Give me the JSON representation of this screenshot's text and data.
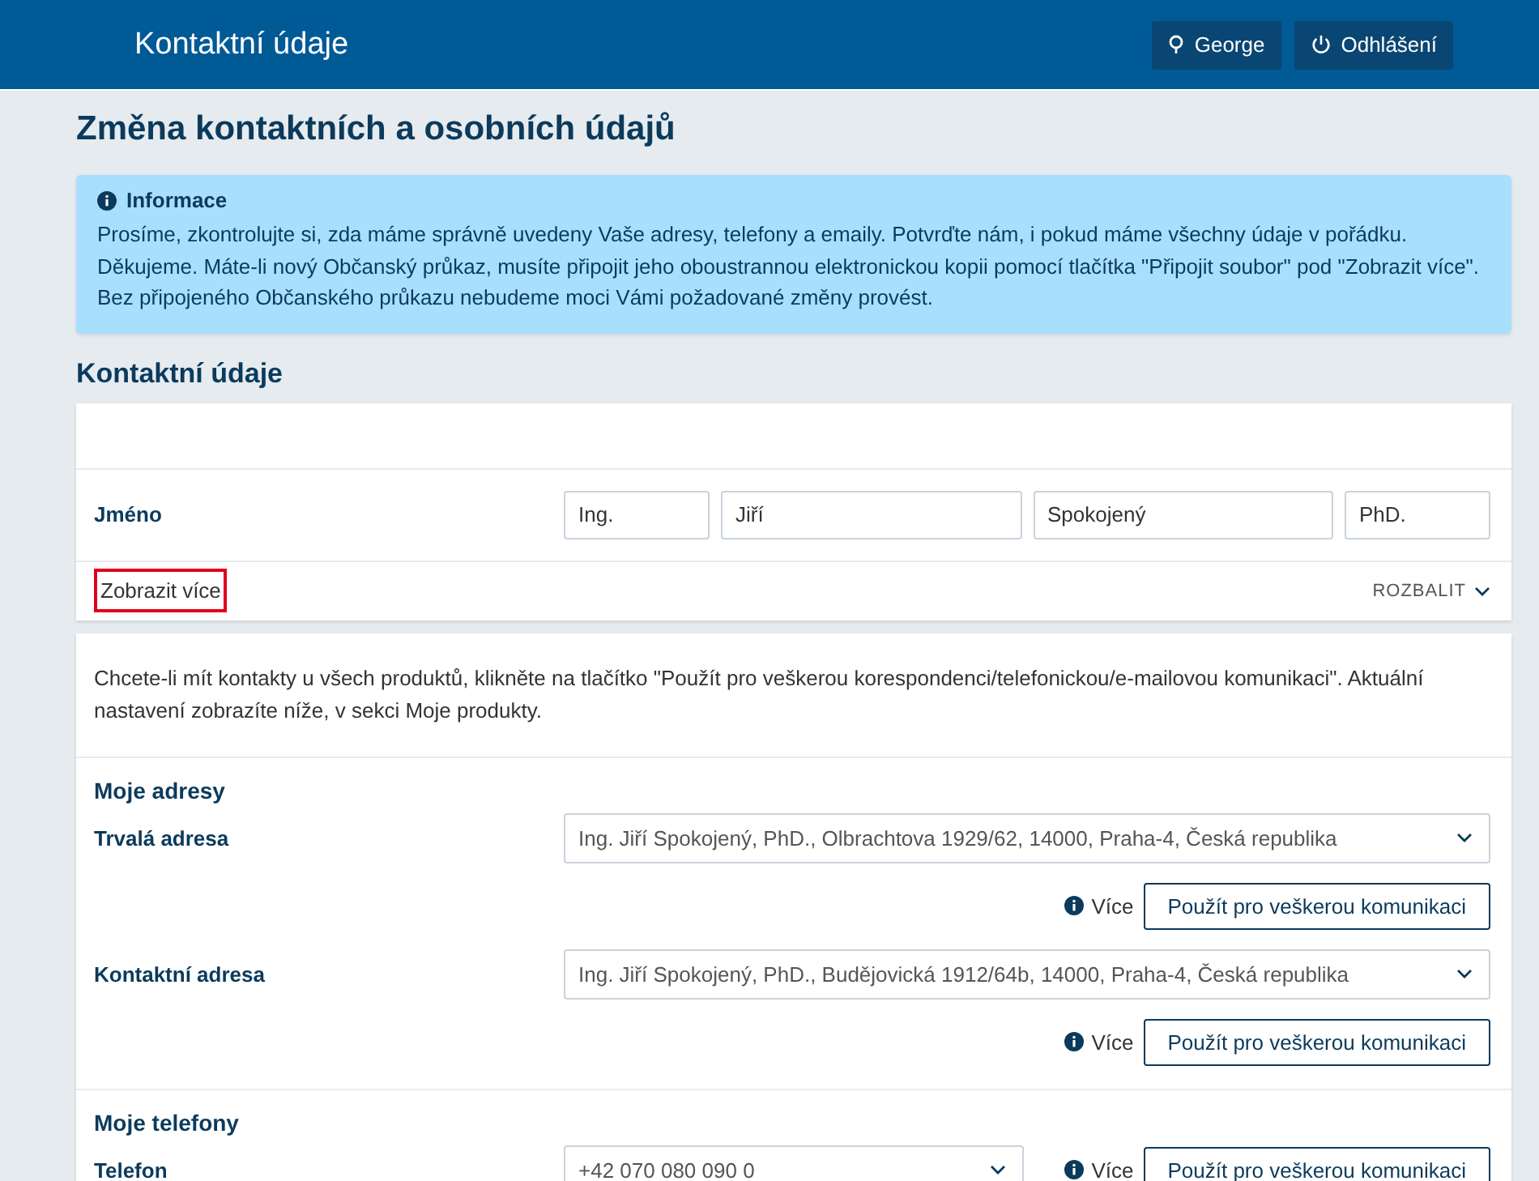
{
  "header": {
    "title": "Kontaktní údaje",
    "buttons": [
      {
        "kind": "user",
        "label": "George"
      },
      {
        "kind": "logout",
        "label": "Odhlášení"
      }
    ]
  },
  "page_title": "Změna kontaktních a osobních údajů",
  "info": {
    "title": "Informace",
    "text": "Prosíme, zkontrolujte si, zda máme správně uvedeny Vaše adresy, telefony a emaily. Potvrďte nám, i pokud máme všechny údaje v pořádku. Děkujeme. Máte-li nový Občanský průkaz, musíte připojit jeho oboustrannou elektronickou kopii pomocí tlačítka \"Připojit soubor\" pod \"Zobrazit více\". Bez připojeného Občanského průkazu nebudeme moci Vámi požadované změny provést."
  },
  "section_title": "Kontaktní údaje",
  "name_row": {
    "label": "Jméno",
    "fields": [
      "Ing.",
      "Jiří",
      "Spokojený",
      "PhD."
    ]
  },
  "show_more": {
    "label": "Zobrazit více",
    "highlighted": true,
    "expand_label": "ROZBALIT"
  },
  "intro": "Chcete-li mít kontakty u všech produktů, klikněte na tlačítko \"Použít pro veškerou korespondenci/telefonickou/e-mailovou komunikaci\". Aktuální nastavení zobrazíte níže, v sekci Moje produkty.",
  "groups": [
    {
      "title": "Moje adresy",
      "rows": [
        {
          "kind": "address",
          "label": "Trvalá adresa",
          "value": "Ing. Jiří Spokojený, PhD., Olbrachtova 1929/62, 14000, Praha-4, Česká republika",
          "more": "Více",
          "button": "Použít pro veškerou komunikaci"
        },
        {
          "kind": "address",
          "label": "Kontaktní adresa",
          "value": "Ing. Jiří Spokojený, PhD., Budějovická 1912/64b, 14000, Praha-4, Česká republika",
          "more": "Více",
          "button": "Použít pro veškerou komunikaci"
        }
      ]
    },
    {
      "title": "Moje telefony",
      "rows": [
        {
          "kind": "phone",
          "label": "Telefon",
          "value": "+42 070 080 090 0",
          "more": "Více",
          "button": "Použít pro veškerou komunikaci"
        }
      ]
    }
  ]
}
